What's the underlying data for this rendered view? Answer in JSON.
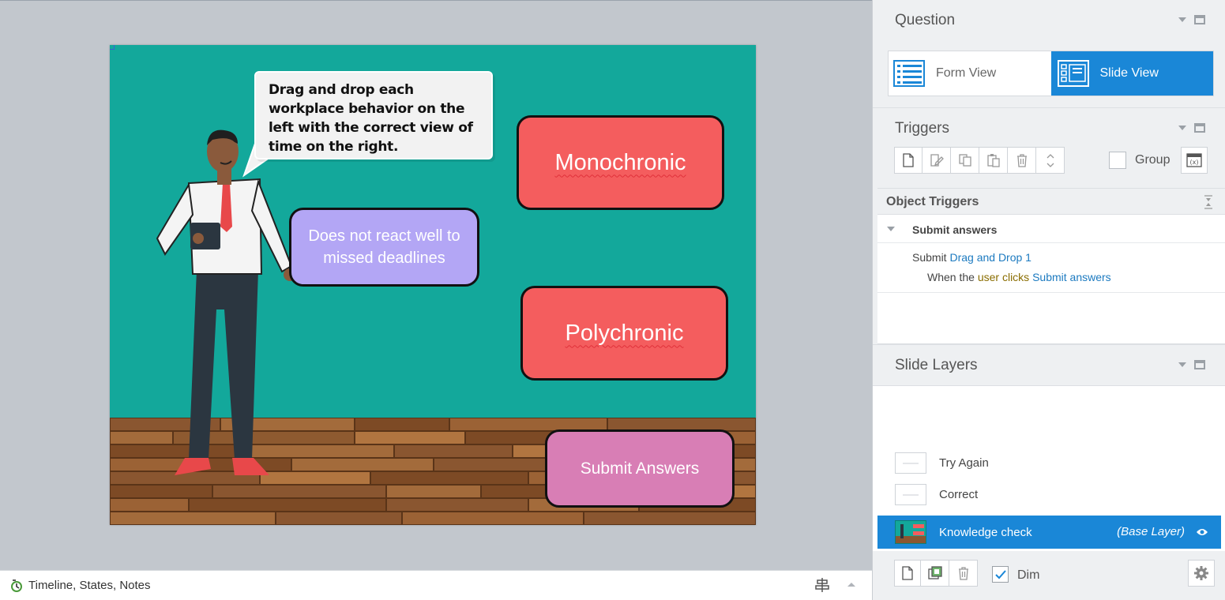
{
  "slide": {
    "instruction": "Drag and drop each workplace behavior on the left with the correct view of time on the right.",
    "drop_targets": [
      "Monochronic",
      "Polychronic"
    ],
    "drag_items": [
      "Does not react well to missed deadlines"
    ],
    "submit_label": "Submit Answers"
  },
  "statusbar": {
    "label": "Timeline, States, Notes"
  },
  "question_panel": {
    "title": "Question",
    "form_view_label": "Form View",
    "slide_view_label": "Slide View",
    "active_view": "Slide View"
  },
  "triggers_panel": {
    "title": "Triggers",
    "group_label": "Group",
    "object_triggers_title": "Object Triggers",
    "group_name": "Submit answers",
    "trigger": {
      "action": "Submit",
      "target": "Drag and Drop 1",
      "when_prefix": "When the",
      "who": "user clicks",
      "object": "Submit answers"
    }
  },
  "layers_panel": {
    "title": "Slide Layers",
    "layers": [
      "Try Again",
      "Correct"
    ],
    "base_layer": {
      "name": "Knowledge check",
      "tag": "(Base Layer)"
    },
    "dim_label": "Dim",
    "dim_checked": true
  },
  "colors": {
    "accent": "#1a87d7",
    "slide_bg": "#13a89b",
    "target_box": "#f45d5e",
    "drag_box": "#b3a6f5",
    "submit_box": "#d87eb5"
  }
}
